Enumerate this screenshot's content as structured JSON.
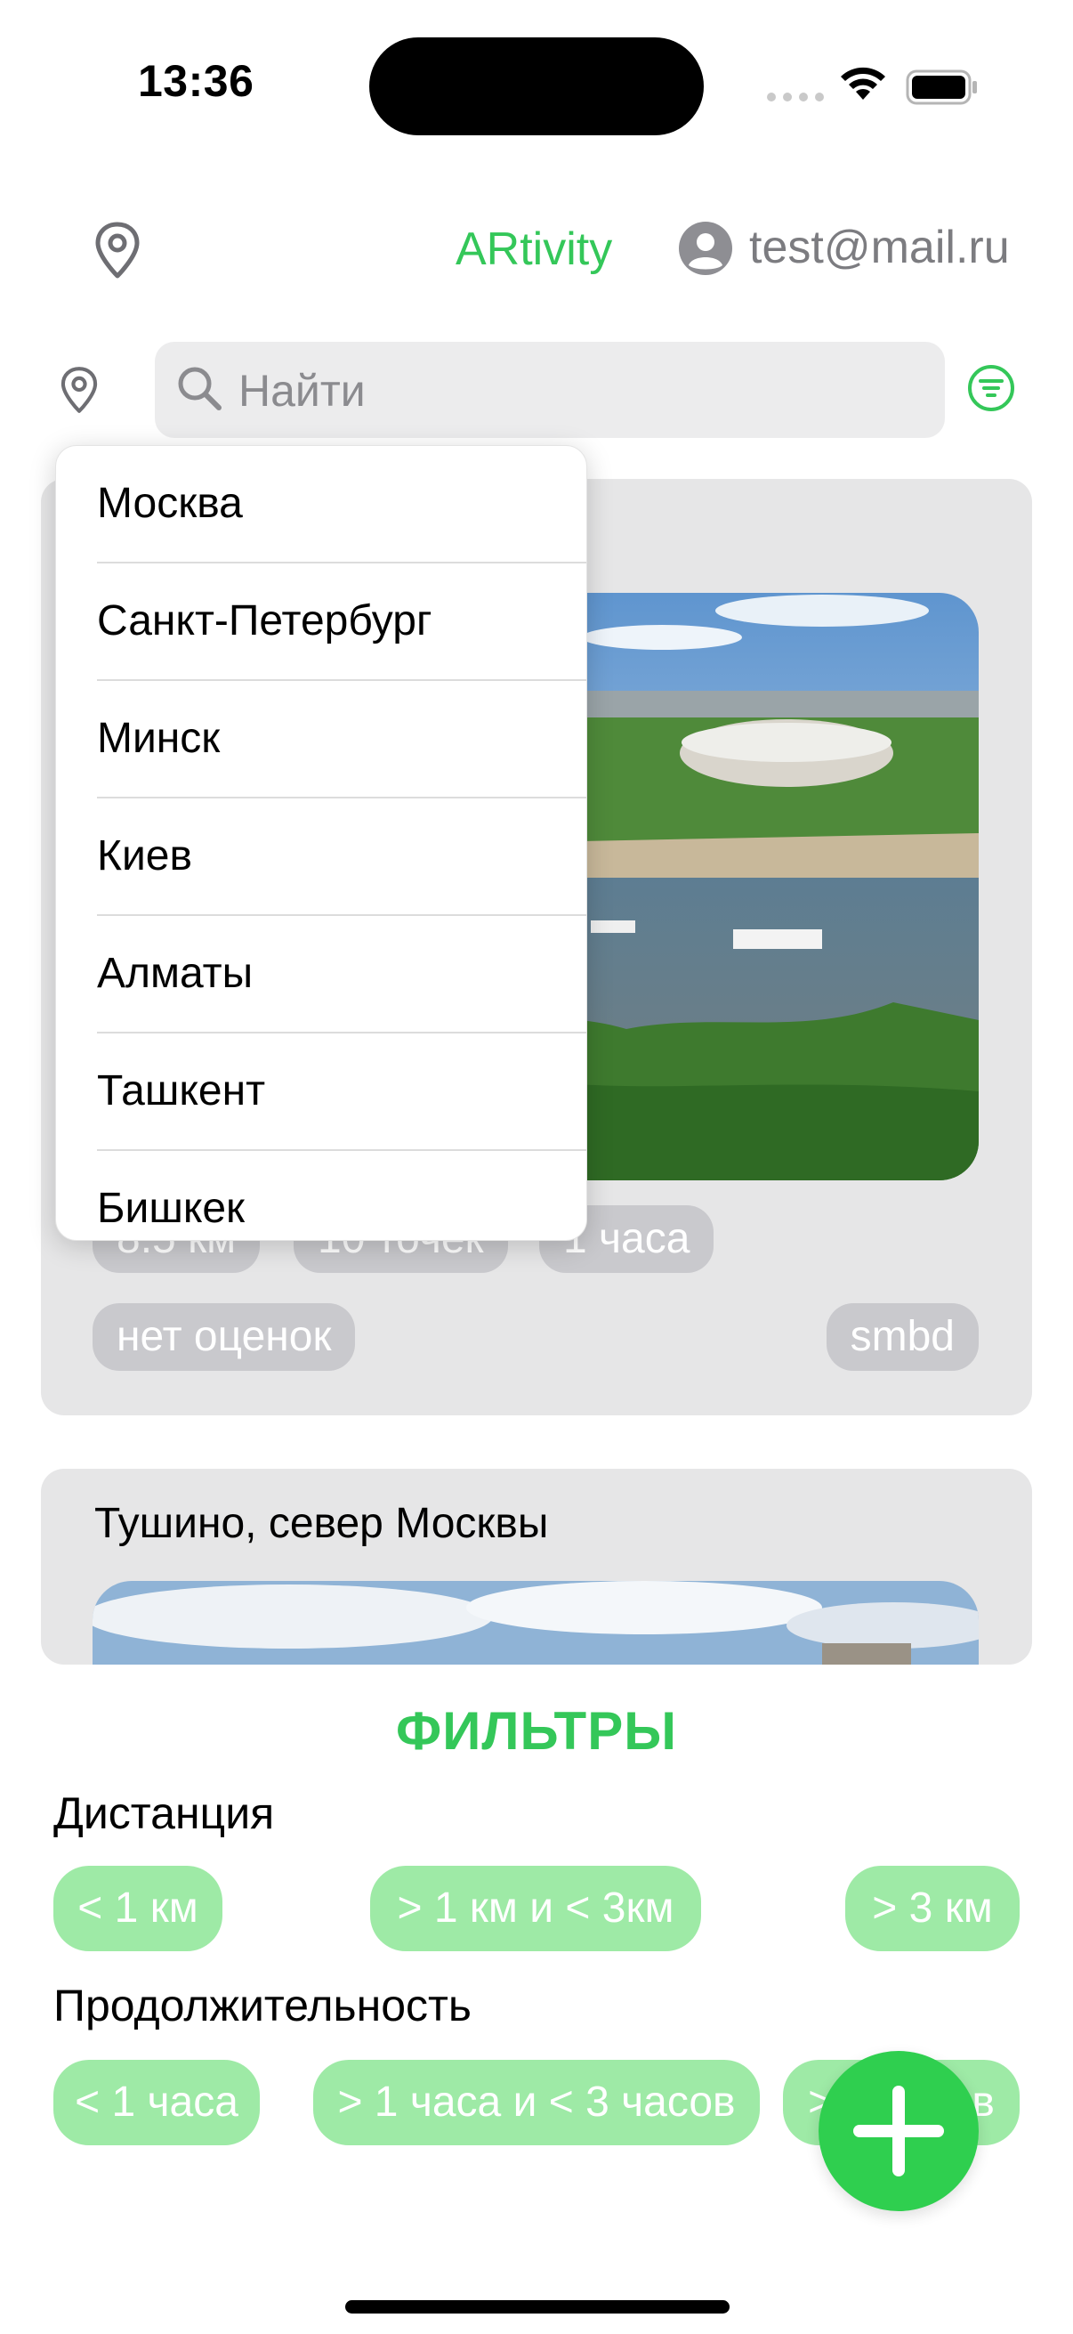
{
  "status_bar": {
    "time": "13:36",
    "icons": [
      "signal-icon",
      "wifi-icon",
      "battery-icon"
    ]
  },
  "header": {
    "app_title": "ARtivity",
    "user_email": "test@mail.ru",
    "icons": [
      "location-pin-icon",
      "user-avatar-icon"
    ]
  },
  "search": {
    "placeholder": "Найти",
    "icons": [
      "location-pin-icon",
      "search-icon",
      "filter-icon"
    ]
  },
  "city_dropdown": {
    "items": [
      "Москва",
      "Санкт-Петербург",
      "Минск",
      "Киев",
      "Алматы",
      "Ташкент",
      "Бишкек"
    ]
  },
  "routes": [
    {
      "chips": [
        "8.5 км",
        "10 точек",
        "1 часа"
      ],
      "rating": "нет оценок",
      "author": "smbd"
    },
    {
      "title": "Тушино, север Москвы"
    }
  ],
  "filters": {
    "title": "ФИЛЬТРЫ",
    "distance": {
      "label": "Дистанция",
      "options": [
        "< 1 км",
        "> 1 км и < 3км",
        "> 3 км"
      ]
    },
    "duration": {
      "label": "Продолжительность",
      "options": [
        "< 1 часа",
        "> 1 часа и < 3 часов",
        "> 3 часов"
      ]
    }
  },
  "colors": {
    "accent": "#34c759",
    "chip_gray": "#c9c9cd",
    "filter_chip": "#9eeaa6",
    "card_bg": "#e6e6e7"
  },
  "fab": {
    "icon": "plus-icon"
  }
}
